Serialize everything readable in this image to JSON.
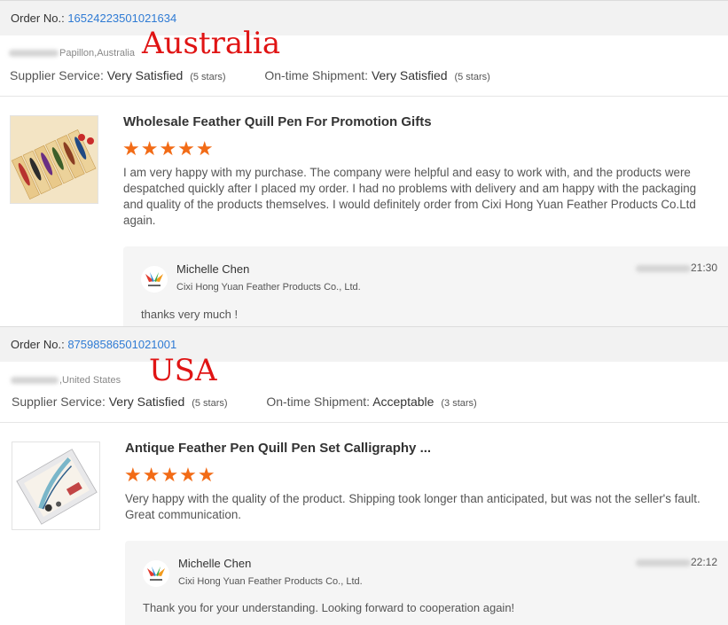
{
  "orders": [
    {
      "order_label": "Order No.:",
      "order_number": "16524223501021634",
      "buyer_location": "Papillon,Australia",
      "country_annotation": "Australia",
      "supplier_service_label": "Supplier Service:",
      "supplier_service_value": "Very Satisfied",
      "supplier_service_stars": "(5 stars)",
      "shipment_label": "On-time Shipment:",
      "shipment_value": "Very Satisfied",
      "shipment_stars": "(5 stars)",
      "product_title": "Wholesale Feather Quill Pen For Promotion Gifts",
      "rating_stars": "★★★★★",
      "review_text": "I am very happy with my purchase.  The company were helpful and easy to work with, and the products were despatched quickly after I placed my order. I had no problems with delivery and am happy with the packaging and quality of the products themselves.  I would definitely order from Cixi Hong Yuan Feather Products Co.Ltd again.",
      "reply": {
        "name": "Michelle Chen",
        "company": "Cixi Hong Yuan Feather Products Co., Ltd.",
        "time": "21:30",
        "message": "thanks very much !"
      }
    },
    {
      "order_label": "Order No.:",
      "order_number": "87598586501021001",
      "buyer_location": ",United States",
      "country_annotation": "USA",
      "supplier_service_label": "Supplier Service:",
      "supplier_service_value": "Very Satisfied",
      "supplier_service_stars": "(5 stars)",
      "shipment_label": "On-time Shipment:",
      "shipment_value": "Acceptable",
      "shipment_stars": "(3 stars)",
      "product_title": "Antique Feather Pen Quill Pen Set Calligraphy ...",
      "rating_stars": "★★★★★",
      "review_text": "Very happy with the quality of the product. Shipping took longer than anticipated, but was not the seller's fault. Great communication.",
      "reply": {
        "name": "Michelle Chen",
        "company": "Cixi Hong Yuan Feather Products Co., Ltd.",
        "time": "22:12",
        "message": "Thank you for your understanding. Looking forward to cooperation again!"
      }
    }
  ],
  "colors": {
    "order_number": "#2f7bd4",
    "stars": "#f26b16",
    "annotation": "#e01414"
  }
}
